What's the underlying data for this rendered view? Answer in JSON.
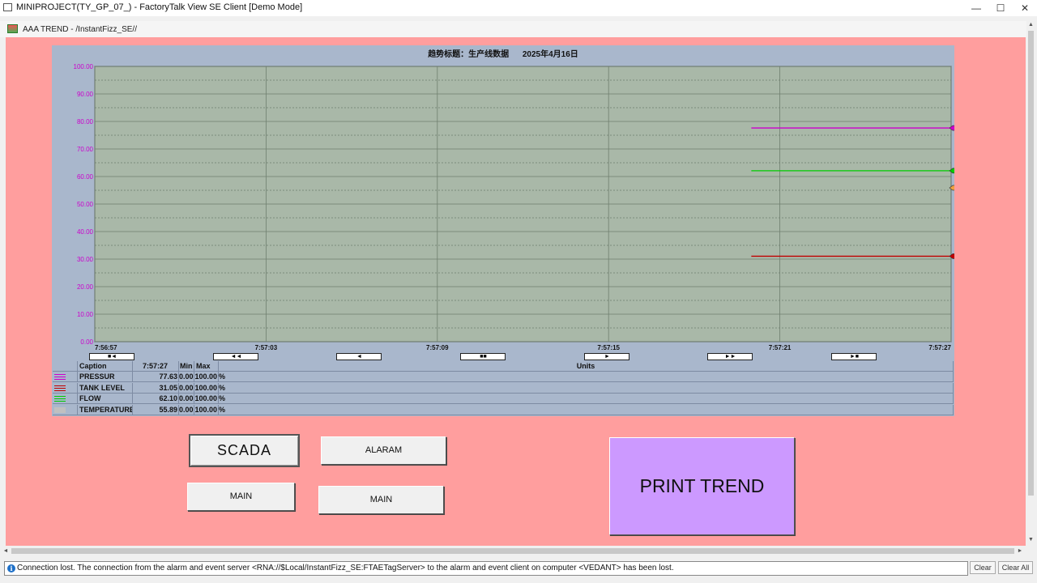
{
  "window": {
    "title": "MINIPROJECT(TY_GP_07_) - FactoryTalk View SE Client  [Demo Mode]",
    "minimize": "—",
    "maximize": "☐",
    "close": "✕"
  },
  "display": {
    "title": "AAA TREND - /InstantFizz_SE//",
    "collapse": "▲",
    "background": "#ff9e9e"
  },
  "trend": {
    "title": "趋势标题：生产线数据      2025年4月16日",
    "nav_buttons": [
      "■ ◄",
      "◄ ◄",
      "◄",
      "■ ■",
      "►",
      "► ►",
      "► ■"
    ]
  },
  "chart_data": {
    "type": "line",
    "title": "趋势标题：生产线数据      2025年4月16日",
    "ylim": [
      0,
      100
    ],
    "y_ticks": [
      "100.00",
      "90.00",
      "80.00",
      "70.00",
      "60.00",
      "50.00",
      "40.00",
      "30.00",
      "20.00",
      "10.00",
      "0.00"
    ],
    "x_ticks": [
      "7:56:57",
      "7:57:03",
      "7:57:09",
      "7:57:15",
      "7:57:21",
      "7:57:27"
    ],
    "x_start_label": "7:56:57",
    "grid": true,
    "series": [
      {
        "name": "PRESSUR",
        "color": "#cc00cc",
        "x": [
          "7:57:20",
          "7:57:27"
        ],
        "values": [
          77.63,
          77.63
        ]
      },
      {
        "name": "TANK LEVEL",
        "color": "#c00000",
        "x": [
          "7:57:20",
          "7:57:27"
        ],
        "values": [
          31.05,
          31.05
        ]
      },
      {
        "name": "FLOW",
        "color": "#00cc00",
        "x": [
          "7:57:20",
          "7:57:27"
        ],
        "values": [
          62.1,
          62.1
        ]
      },
      {
        "name": "TEMPERATURE",
        "color": "#f0a040",
        "x": [
          "7:57:27"
        ],
        "values": [
          55.89
        ]
      }
    ]
  },
  "legend": {
    "headers": {
      "caption": "Caption",
      "time": "7:57:27",
      "min": "Min",
      "max": "Max",
      "units": "Units"
    },
    "rows": [
      {
        "caption": "PRESSUR",
        "value": "77.63",
        "min": "0.00",
        "max": "100.00",
        "units": "%",
        "color": "#cc00cc"
      },
      {
        "caption": "TANK LEVEL",
        "value": "31.05",
        "min": "0.00",
        "max": "100.00",
        "units": "%",
        "color": "#c00000"
      },
      {
        "caption": "FLOW",
        "value": "62.10",
        "min": "0.00",
        "max": "100.00",
        "units": "%",
        "color": "#00cc00"
      },
      {
        "caption": "TEMPERATURE",
        "value": "55.89",
        "min": "0.00",
        "max": "100.00",
        "units": "%",
        "color": "#c0c0c0"
      }
    ]
  },
  "buttons": {
    "scada": "SCADA",
    "alarm": "ALARAM",
    "main1": "MAIN",
    "main2": "MAIN",
    "print": "PRINT TREND"
  },
  "status": {
    "message": "Connection lost. The connection from the alarm and event server <RNA://$Local/InstantFizz_SE:FTAETagServer> to the alarm and event client on computer <VEDANT> has been lost.",
    "clear": "Clear",
    "clear_all": "Clear All"
  }
}
